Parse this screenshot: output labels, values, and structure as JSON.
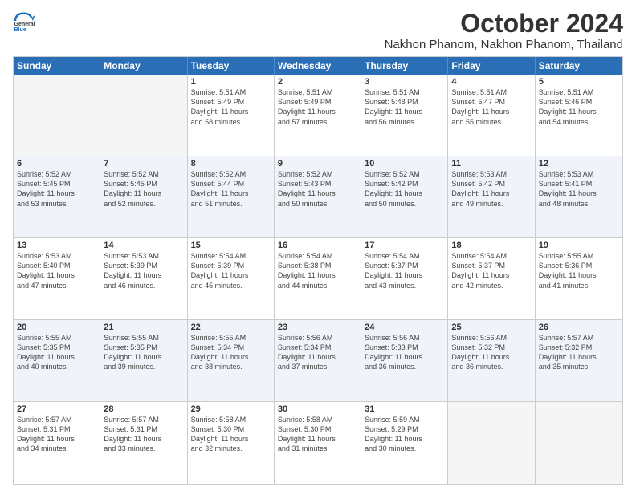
{
  "logo": {
    "line1": "General",
    "line2": "Blue"
  },
  "title": "October 2024",
  "location": "Nakhon Phanom, Nakhon Phanom, Thailand",
  "weekdays": [
    "Sunday",
    "Monday",
    "Tuesday",
    "Wednesday",
    "Thursday",
    "Friday",
    "Saturday"
  ],
  "weeks": [
    [
      {
        "day": "",
        "empty": true
      },
      {
        "day": "",
        "empty": true
      },
      {
        "day": "1",
        "sr": "Sunrise: 5:51 AM",
        "ss": "Sunset: 5:49 PM",
        "dl": "Daylight: 11 hours",
        "dl2": "and 58 minutes."
      },
      {
        "day": "2",
        "sr": "Sunrise: 5:51 AM",
        "ss": "Sunset: 5:49 PM",
        "dl": "Daylight: 11 hours",
        "dl2": "and 57 minutes."
      },
      {
        "day": "3",
        "sr": "Sunrise: 5:51 AM",
        "ss": "Sunset: 5:48 PM",
        "dl": "Daylight: 11 hours",
        "dl2": "and 56 minutes."
      },
      {
        "day": "4",
        "sr": "Sunrise: 5:51 AM",
        "ss": "Sunset: 5:47 PM",
        "dl": "Daylight: 11 hours",
        "dl2": "and 55 minutes."
      },
      {
        "day": "5",
        "sr": "Sunrise: 5:51 AM",
        "ss": "Sunset: 5:46 PM",
        "dl": "Daylight: 11 hours",
        "dl2": "and 54 minutes."
      }
    ],
    [
      {
        "day": "6",
        "sr": "Sunrise: 5:52 AM",
        "ss": "Sunset: 5:45 PM",
        "dl": "Daylight: 11 hours",
        "dl2": "and 53 minutes."
      },
      {
        "day": "7",
        "sr": "Sunrise: 5:52 AM",
        "ss": "Sunset: 5:45 PM",
        "dl": "Daylight: 11 hours",
        "dl2": "and 52 minutes."
      },
      {
        "day": "8",
        "sr": "Sunrise: 5:52 AM",
        "ss": "Sunset: 5:44 PM",
        "dl": "Daylight: 11 hours",
        "dl2": "and 51 minutes."
      },
      {
        "day": "9",
        "sr": "Sunrise: 5:52 AM",
        "ss": "Sunset: 5:43 PM",
        "dl": "Daylight: 11 hours",
        "dl2": "and 50 minutes."
      },
      {
        "day": "10",
        "sr": "Sunrise: 5:52 AM",
        "ss": "Sunset: 5:42 PM",
        "dl": "Daylight: 11 hours",
        "dl2": "and 50 minutes."
      },
      {
        "day": "11",
        "sr": "Sunrise: 5:53 AM",
        "ss": "Sunset: 5:42 PM",
        "dl": "Daylight: 11 hours",
        "dl2": "and 49 minutes."
      },
      {
        "day": "12",
        "sr": "Sunrise: 5:53 AM",
        "ss": "Sunset: 5:41 PM",
        "dl": "Daylight: 11 hours",
        "dl2": "and 48 minutes."
      }
    ],
    [
      {
        "day": "13",
        "sr": "Sunrise: 5:53 AM",
        "ss": "Sunset: 5:40 PM",
        "dl": "Daylight: 11 hours",
        "dl2": "and 47 minutes."
      },
      {
        "day": "14",
        "sr": "Sunrise: 5:53 AM",
        "ss": "Sunset: 5:39 PM",
        "dl": "Daylight: 11 hours",
        "dl2": "and 46 minutes."
      },
      {
        "day": "15",
        "sr": "Sunrise: 5:54 AM",
        "ss": "Sunset: 5:39 PM",
        "dl": "Daylight: 11 hours",
        "dl2": "and 45 minutes."
      },
      {
        "day": "16",
        "sr": "Sunrise: 5:54 AM",
        "ss": "Sunset: 5:38 PM",
        "dl": "Daylight: 11 hours",
        "dl2": "and 44 minutes."
      },
      {
        "day": "17",
        "sr": "Sunrise: 5:54 AM",
        "ss": "Sunset: 5:37 PM",
        "dl": "Daylight: 11 hours",
        "dl2": "and 43 minutes."
      },
      {
        "day": "18",
        "sr": "Sunrise: 5:54 AM",
        "ss": "Sunset: 5:37 PM",
        "dl": "Daylight: 11 hours",
        "dl2": "and 42 minutes."
      },
      {
        "day": "19",
        "sr": "Sunrise: 5:55 AM",
        "ss": "Sunset: 5:36 PM",
        "dl": "Daylight: 11 hours",
        "dl2": "and 41 minutes."
      }
    ],
    [
      {
        "day": "20",
        "sr": "Sunrise: 5:55 AM",
        "ss": "Sunset: 5:35 PM",
        "dl": "Daylight: 11 hours",
        "dl2": "and 40 minutes."
      },
      {
        "day": "21",
        "sr": "Sunrise: 5:55 AM",
        "ss": "Sunset: 5:35 PM",
        "dl": "Daylight: 11 hours",
        "dl2": "and 39 minutes."
      },
      {
        "day": "22",
        "sr": "Sunrise: 5:55 AM",
        "ss": "Sunset: 5:34 PM",
        "dl": "Daylight: 11 hours",
        "dl2": "and 38 minutes."
      },
      {
        "day": "23",
        "sr": "Sunrise: 5:56 AM",
        "ss": "Sunset: 5:34 PM",
        "dl": "Daylight: 11 hours",
        "dl2": "and 37 minutes."
      },
      {
        "day": "24",
        "sr": "Sunrise: 5:56 AM",
        "ss": "Sunset: 5:33 PM",
        "dl": "Daylight: 11 hours",
        "dl2": "and 36 minutes."
      },
      {
        "day": "25",
        "sr": "Sunrise: 5:56 AM",
        "ss": "Sunset: 5:32 PM",
        "dl": "Daylight: 11 hours",
        "dl2": "and 36 minutes."
      },
      {
        "day": "26",
        "sr": "Sunrise: 5:57 AM",
        "ss": "Sunset: 5:32 PM",
        "dl": "Daylight: 11 hours",
        "dl2": "and 35 minutes."
      }
    ],
    [
      {
        "day": "27",
        "sr": "Sunrise: 5:57 AM",
        "ss": "Sunset: 5:31 PM",
        "dl": "Daylight: 11 hours",
        "dl2": "and 34 minutes."
      },
      {
        "day": "28",
        "sr": "Sunrise: 5:57 AM",
        "ss": "Sunset: 5:31 PM",
        "dl": "Daylight: 11 hours",
        "dl2": "and 33 minutes."
      },
      {
        "day": "29",
        "sr": "Sunrise: 5:58 AM",
        "ss": "Sunset: 5:30 PM",
        "dl": "Daylight: 11 hours",
        "dl2": "and 32 minutes."
      },
      {
        "day": "30",
        "sr": "Sunrise: 5:58 AM",
        "ss": "Sunset: 5:30 PM",
        "dl": "Daylight: 11 hours",
        "dl2": "and 31 minutes."
      },
      {
        "day": "31",
        "sr": "Sunrise: 5:59 AM",
        "ss": "Sunset: 5:29 PM",
        "dl": "Daylight: 11 hours",
        "dl2": "and 30 minutes."
      },
      {
        "day": "",
        "empty": true
      },
      {
        "day": "",
        "empty": true
      }
    ]
  ]
}
